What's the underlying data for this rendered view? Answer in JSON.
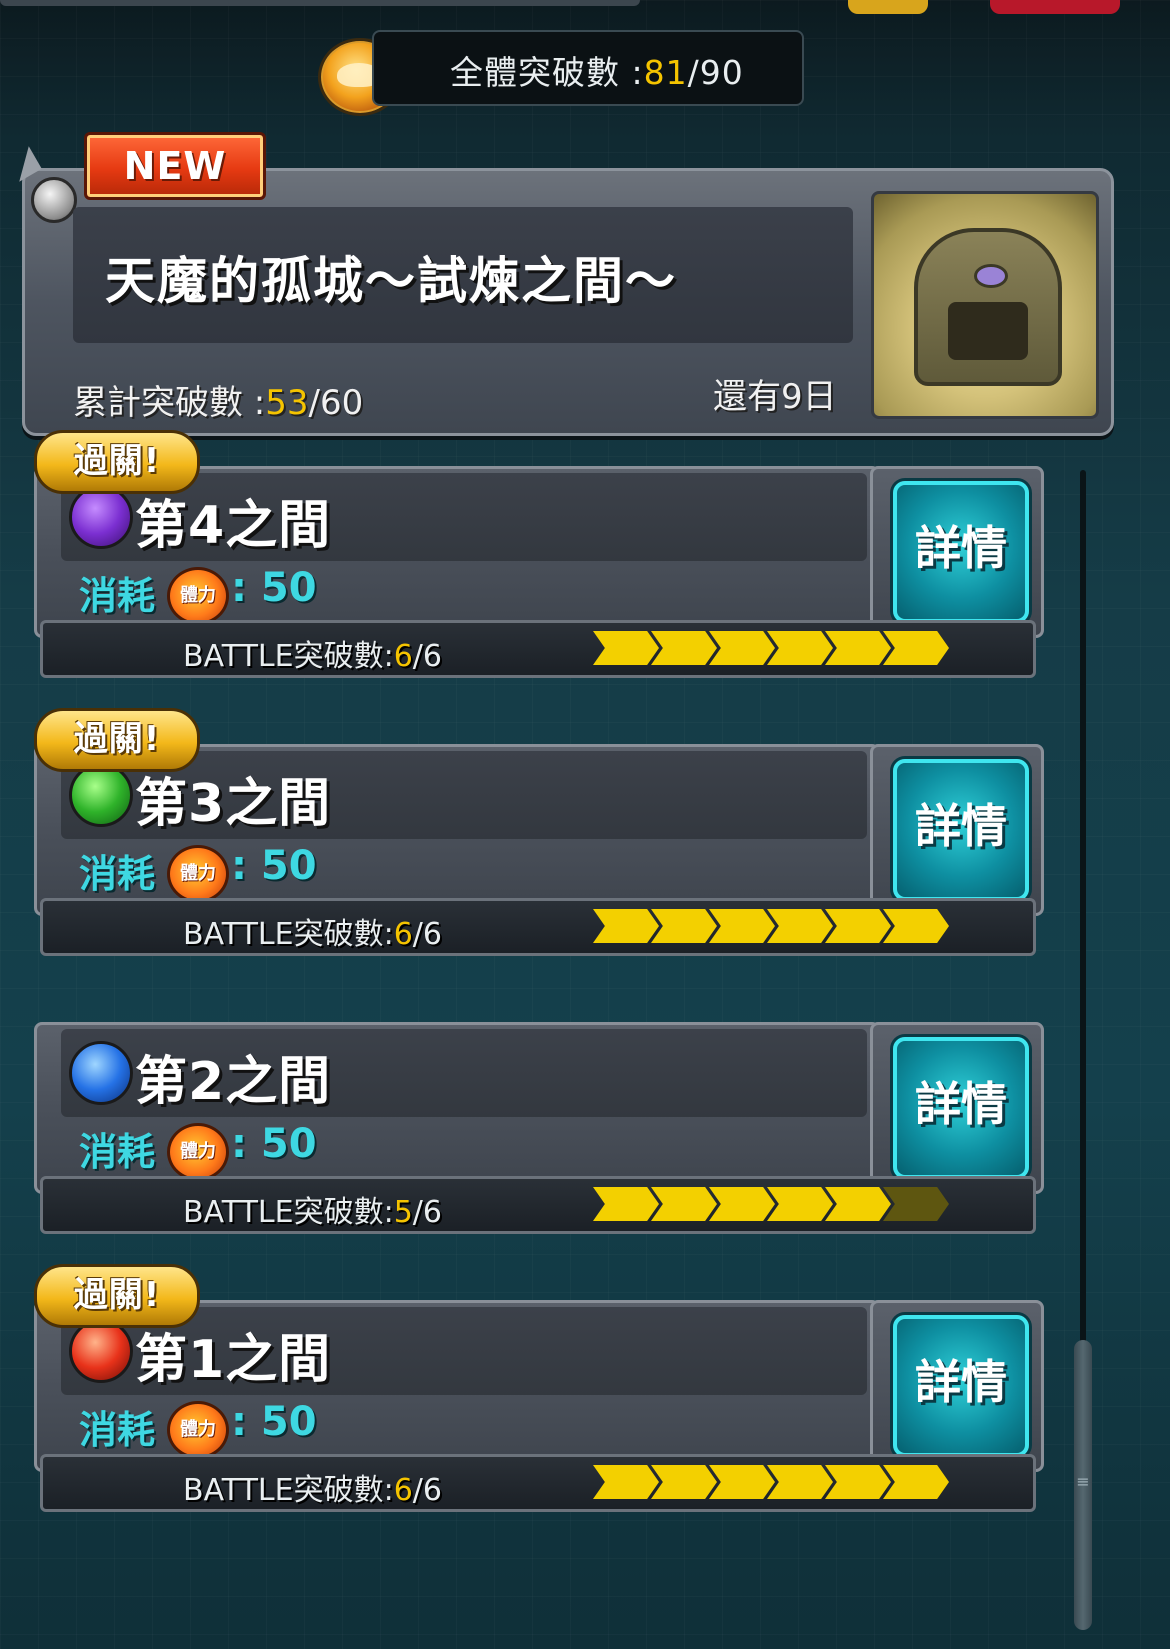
{
  "header": {
    "total_label": "全體突破數",
    "total_current": "81",
    "total_max": "/90"
  },
  "quest": {
    "badge": "NEW",
    "name": "天魔的孤城～試煉之間～",
    "accum_label": "累計突破數",
    "accum_current": "53",
    "accum_max": "/60",
    "remaining": "還有9日"
  },
  "rooms": [
    {
      "cleared_label": "過關!",
      "name": "第4之間",
      "element": "dark-element-icon",
      "cost_label": "消耗",
      "stamina_icon_text": "體力",
      "cost_value": ": 50",
      "detail_label": "詳情",
      "battle_label": "BATTLE突破數:",
      "battle_current": "6",
      "battle_max": "/6",
      "progress": 6,
      "progress_total": 6
    },
    {
      "cleared_label": "過關!",
      "name": "第3之間",
      "element": "wood-element-icon",
      "cost_label": "消耗",
      "stamina_icon_text": "體力",
      "cost_value": ": 50",
      "detail_label": "詳情",
      "battle_label": "BATTLE突破數:",
      "battle_current": "6",
      "battle_max": "/6",
      "progress": 6,
      "progress_total": 6
    },
    {
      "cleared_label": "",
      "name": "第2之間",
      "element": "water-element-icon",
      "cost_label": "消耗",
      "stamina_icon_text": "體力",
      "cost_value": ": 50",
      "detail_label": "詳情",
      "battle_label": "BATTLE突破數:",
      "battle_current": "5",
      "battle_max": "/6",
      "progress": 5,
      "progress_total": 6
    },
    {
      "cleared_label": "過關!",
      "name": "第1之間",
      "element": "fire-element-icon",
      "cost_label": "消耗",
      "stamina_icon_text": "體力",
      "cost_value": ": 50",
      "detail_label": "詳情",
      "battle_label": "BATTLE突破數:",
      "battle_current": "6",
      "battle_max": "/6",
      "progress": 6,
      "progress_total": 6
    }
  ],
  "colors": {
    "accent_gold": "#f5c400",
    "accent_cyan": "#3ed8e2",
    "progress_on": "#f3d000",
    "progress_off": "#5e5610"
  }
}
